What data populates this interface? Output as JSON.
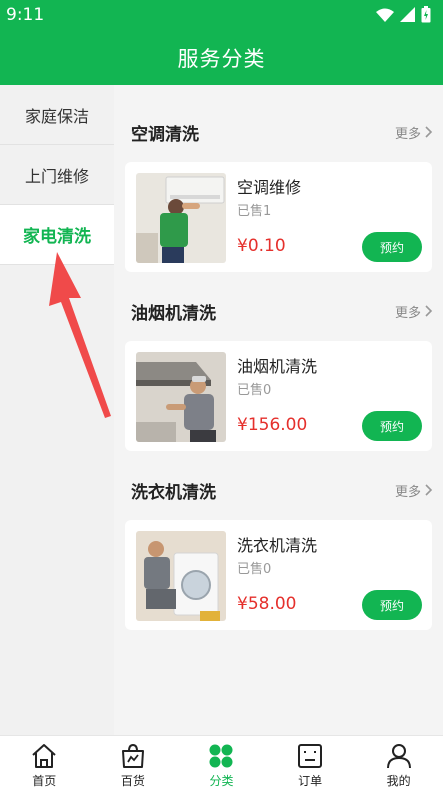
{
  "status_bar": {
    "time": "9:11",
    "icons": [
      "wifi-icon",
      "signal-icon",
      "battery-icon"
    ]
  },
  "header": {
    "title": "服务分类"
  },
  "sidebar": {
    "items": [
      {
        "label": "家庭保洁",
        "active": false
      },
      {
        "label": "上门维修",
        "active": false
      },
      {
        "label": "家电清洗",
        "active": true
      }
    ]
  },
  "sections": [
    {
      "title": "空调清洗",
      "more": "更多",
      "item": {
        "name": "空调维修",
        "sold": "已售1",
        "price": "¥0.10",
        "button": "预约"
      }
    },
    {
      "title": "油烟机清洗",
      "more": "更多",
      "item": {
        "name": "油烟机清洗",
        "sold": "已售0",
        "price": "¥156.00",
        "button": "预约"
      }
    },
    {
      "title": "洗衣机清洗",
      "more": "更多",
      "item": {
        "name": "洗衣机清洗",
        "sold": "已售0",
        "price": "¥58.00",
        "button": "预约"
      }
    }
  ],
  "tabbar": {
    "tabs": [
      {
        "label": "首页",
        "icon": "home-icon",
        "active": false
      },
      {
        "label": "百货",
        "icon": "shopping-bag-icon",
        "active": false
      },
      {
        "label": "分类",
        "icon": "category-icon",
        "active": true
      },
      {
        "label": "订单",
        "icon": "order-icon",
        "active": false
      },
      {
        "label": "我的",
        "icon": "profile-icon",
        "active": false
      }
    ]
  },
  "colors": {
    "brand": "#12b552",
    "price": "#e5302c",
    "arrow": "#f04a4a"
  }
}
